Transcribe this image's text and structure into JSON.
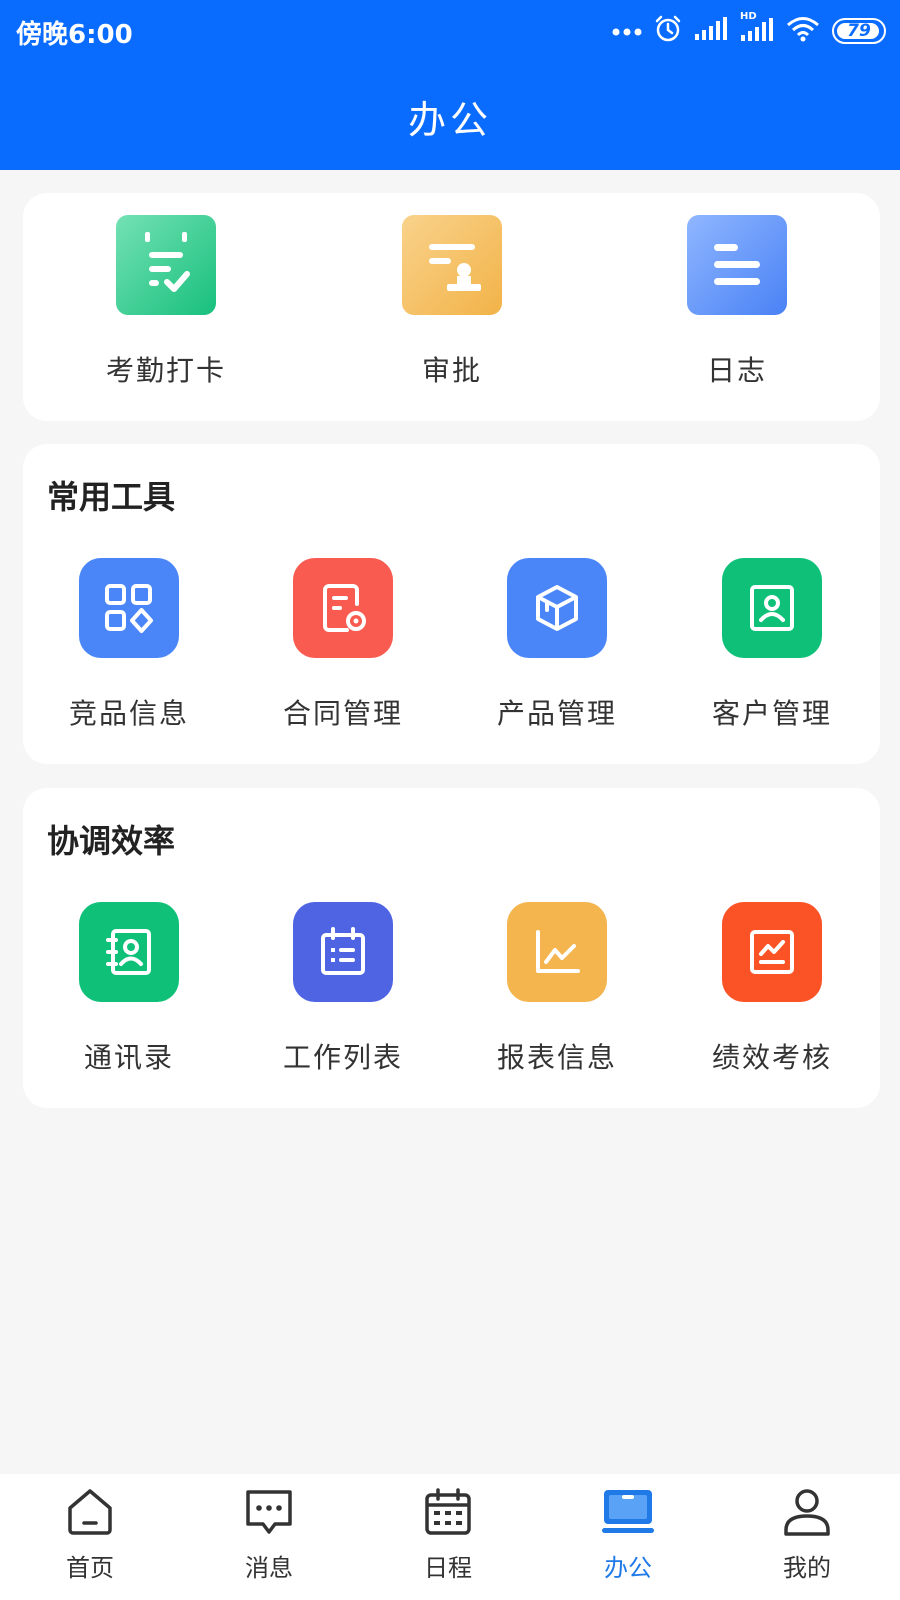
{
  "status_bar": {
    "time": "傍晚6:00",
    "battery": "79",
    "network_hd": "HD"
  },
  "header": {
    "title": "办公"
  },
  "top_actions": [
    {
      "label": "考勤打卡",
      "icon": "attendance-check-icon"
    },
    {
      "label": "审批",
      "icon": "approval-stamp-icon"
    },
    {
      "label": "日志",
      "icon": "log-lines-icon"
    }
  ],
  "common_tools": {
    "title": "常用工具",
    "items": [
      {
        "label": "竞品信息",
        "icon": "apps-grid-icon"
      },
      {
        "label": "合同管理",
        "icon": "contract-document-icon"
      },
      {
        "label": "产品管理",
        "icon": "product-box-icon"
      },
      {
        "label": "客户管理",
        "icon": "customer-card-icon"
      }
    ]
  },
  "coordination": {
    "title": "协调效率",
    "items": [
      {
        "label": "通讯录",
        "icon": "contacts-book-icon"
      },
      {
        "label": "工作列表",
        "icon": "work-list-calendar-icon"
      },
      {
        "label": "报表信息",
        "icon": "report-chart-icon"
      },
      {
        "label": "绩效考核",
        "icon": "performance-chart-icon"
      }
    ]
  },
  "tabbar": {
    "items": [
      {
        "label": "首页",
        "icon": "home-icon",
        "active": false
      },
      {
        "label": "消息",
        "icon": "message-bubble-icon",
        "active": false
      },
      {
        "label": "日程",
        "icon": "calendar-icon",
        "active": false
      },
      {
        "label": "办公",
        "icon": "laptop-office-icon",
        "active": true
      },
      {
        "label": "我的",
        "icon": "person-icon",
        "active": false
      }
    ]
  },
  "colors": {
    "primary": "#0a6cff",
    "tab_active": "#1f7ae8",
    "green": "#0fc079",
    "orange": "#f4b44e",
    "blue": "#4a86f7",
    "red": "#f95b50",
    "indigo": "#4e64e3",
    "deep_orange": "#fb5325"
  }
}
